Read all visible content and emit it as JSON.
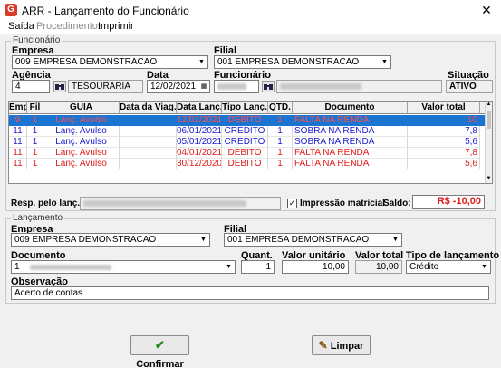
{
  "window": {
    "title": "ARR - Lançamento do Funcionário",
    "close_glyph": "✕",
    "app_icon_letter": "G"
  },
  "menu": {
    "items": [
      "Saída",
      "Procedimentos",
      "Imprimir"
    ]
  },
  "funcionario_group": {
    "legend": "Funcionário",
    "empresa_label": "Empresa",
    "empresa_value": "009 EMPRESA DEMONSTRACAO",
    "filial_label": "Filial",
    "filial_value": "001 EMPRESA DEMONSTRACAO",
    "agencia_label": "Agência",
    "agencia_value": "4",
    "agencia_name": "TESOURARIA",
    "data_label": "Data",
    "data_value": "12/02/2021",
    "funcionario_label": "Funcionário",
    "situacao_label": "Situação",
    "situacao_value": "ATIVO"
  },
  "grid": {
    "columns": [
      "Emp",
      "Fil",
      "GUIA",
      "Data da Viag.",
      "Data Lanç.",
      "Tipo Lanç.",
      "QTD.",
      "Documento",
      "Valor total"
    ],
    "rows": [
      {
        "emp": "9",
        "fil": "1",
        "guia": "Lanç. Avulso",
        "viag": "",
        "lanc": "12/02/2021",
        "tipo": "DÉBITO",
        "qtd": "1",
        "doc": "FALTA NA RENDA",
        "valor": "10"
      },
      {
        "emp": "11",
        "fil": "1",
        "guia": "Lanç. Avulso",
        "viag": "",
        "lanc": "06/01/2021",
        "tipo": "CRÉDITO",
        "qtd": "1",
        "doc": "SOBRA NA RENDA",
        "valor": "7,8"
      },
      {
        "emp": "11",
        "fil": "1",
        "guia": "Lanç. Avulso",
        "viag": "",
        "lanc": "05/01/2021",
        "tipo": "CRÉDITO",
        "qtd": "1",
        "doc": "SOBRA NA RENDA",
        "valor": "5,6"
      },
      {
        "emp": "11",
        "fil": "1",
        "guia": "Lanç. Avulso",
        "viag": "",
        "lanc": "04/01/2021",
        "tipo": "DÉBITO",
        "qtd": "1",
        "doc": "FALTA NA RENDA",
        "valor": "7,8"
      },
      {
        "emp": "11",
        "fil": "1",
        "guia": "Lanç. Avulso",
        "viag": "",
        "lanc": "30/12/2020",
        "tipo": "DÉBITO",
        "qtd": "1",
        "doc": "FALTA NA RENDA",
        "valor": "5,6"
      }
    ],
    "selected_index": 0
  },
  "footer_row": {
    "resp_label": "Resp. pelo lanç.:",
    "impressao_label": "Impressão matricial",
    "impressao_checked": "✓",
    "saldo_label": "Saldo:",
    "saldo_value": "R$ -10,00"
  },
  "lancamento_group": {
    "legend": "Lançamento",
    "empresa_label": "Empresa",
    "empresa_value": "009 EMPRESA DEMONSTRACAO",
    "filial_label": "Filial",
    "filial_value": "001 EMPRESA DEMONSTRACAO",
    "documento_label": "Documento",
    "documento_value": "1",
    "quant_label": "Quant.",
    "quant_value": "1",
    "valor_unit_label": "Valor unitário",
    "valor_unit_value": "10,00",
    "valor_total_label": "Valor total",
    "valor_total_value": "10,00",
    "tipo_label": "Tipo de lançamento",
    "tipo_value": "Crédito",
    "obs_label": "Observação",
    "obs_value": "Acerto de contas."
  },
  "buttons": {
    "confirmar": "Confirmar",
    "limpar": "Limpar"
  },
  "colors": {
    "credit": "#1a1ad0",
    "debit": "#e01b1b",
    "selection": "#1a75d2",
    "saldo": "#e01b1b"
  },
  "icons": [
    "app-logo-icon",
    "close-icon",
    "chevron-down-icon",
    "binoculars-icon",
    "calendar-icon",
    "checkmark-icon",
    "broom-icon"
  ]
}
